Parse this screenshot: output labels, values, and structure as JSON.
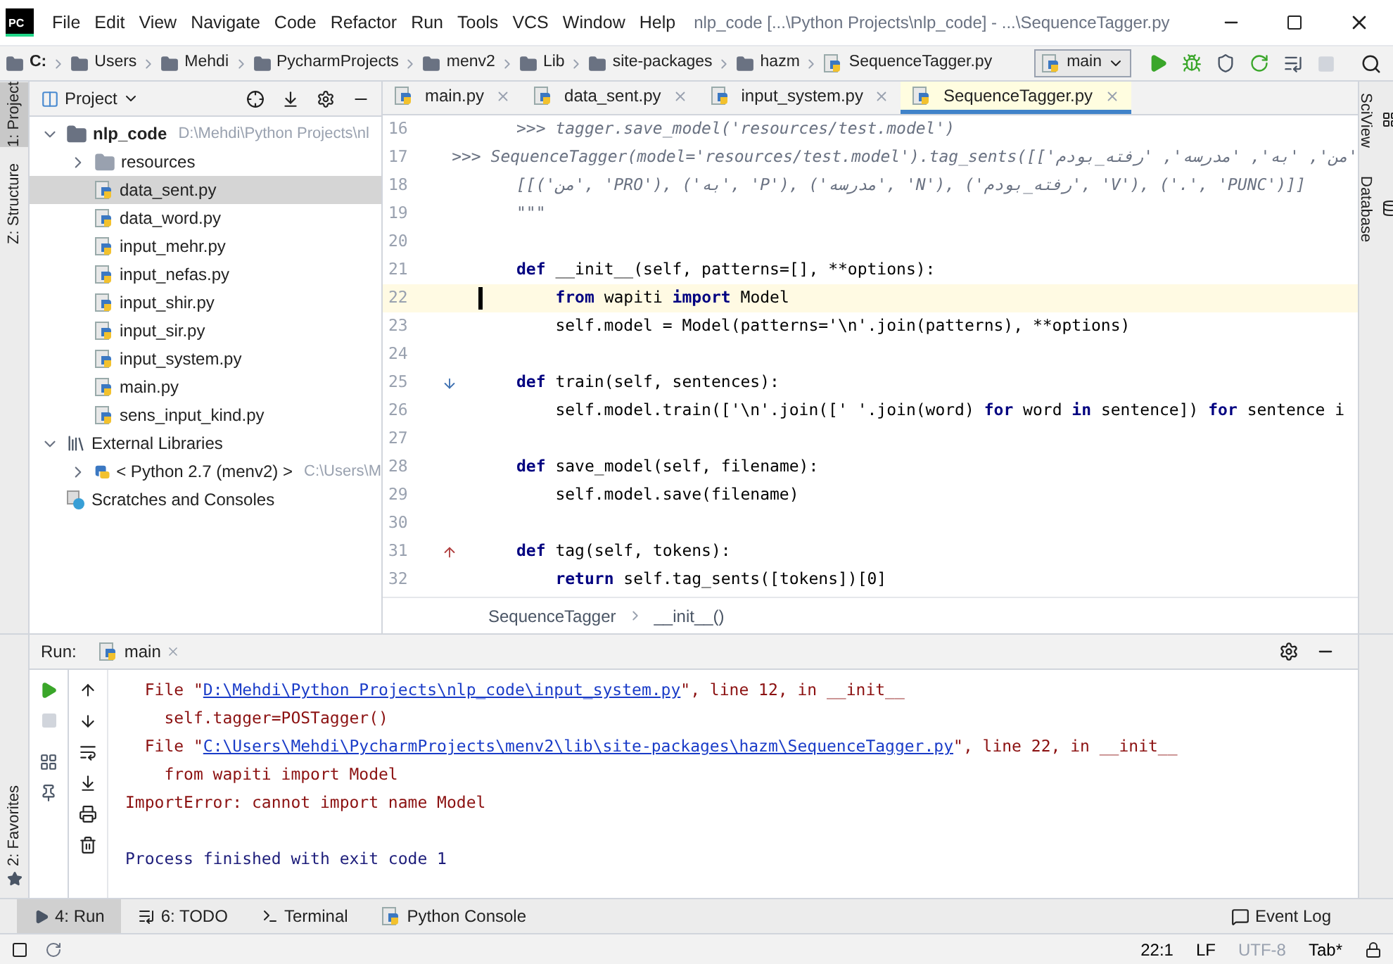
{
  "window": {
    "logo": "PC",
    "title": "nlp_code [...\\Python Projects\\nlp_code] - ...\\SequenceTagger.py"
  },
  "menu": [
    "File",
    "Edit",
    "View",
    "Navigate",
    "Code",
    "Refactor",
    "Run",
    "Tools",
    "VCS",
    "Window",
    "Help"
  ],
  "breadcrumb": [
    "C:",
    "Users",
    "Mehdi",
    "PycharmProjects",
    "menv2",
    "Lib",
    "site-packages",
    "hazm",
    "SequenceTagger.py"
  ],
  "run_config": "main",
  "left_stripe": [
    {
      "label": "1: Project",
      "selected": true
    },
    {
      "label": "Z: Structure",
      "selected": false
    }
  ],
  "favorites": "2: Favorites",
  "right_stripe": [
    "SciView",
    "Database"
  ],
  "project": {
    "title": "Project",
    "tree": [
      {
        "label": "nlp_code",
        "hint": "D:\\Mehdi\\Python Projects\\nl",
        "kind": "root",
        "expanded": true,
        "selected": false,
        "children": [
          {
            "label": "resources",
            "kind": "folder",
            "expanded": false,
            "selected": false
          },
          {
            "label": "data_sent.py",
            "kind": "file",
            "selected": true
          },
          {
            "label": "data_word.py",
            "kind": "file",
            "selected": false
          },
          {
            "label": "input_mehr.py",
            "kind": "file",
            "selected": false
          },
          {
            "label": "input_nefas.py",
            "kind": "file",
            "selected": false
          },
          {
            "label": "input_shir.py",
            "kind": "file",
            "selected": false
          },
          {
            "label": "input_sir.py",
            "kind": "file",
            "selected": false
          },
          {
            "label": "input_system.py",
            "kind": "file",
            "selected": false
          },
          {
            "label": "main.py",
            "kind": "file",
            "selected": false
          },
          {
            "label": "sens_input_kind.py",
            "kind": "file",
            "selected": false
          }
        ]
      },
      {
        "label": "External Libraries",
        "kind": "library",
        "expanded": true,
        "selected": false,
        "children": [
          {
            "label": "< Python 2.7 (menv2) >",
            "hint": "C:\\Users\\M",
            "kind": "python",
            "expanded": false,
            "selected": false
          }
        ]
      },
      {
        "label": "Scratches and Consoles",
        "kind": "scratches",
        "selected": false
      }
    ]
  },
  "editor": {
    "tabs": [
      {
        "label": "main.py",
        "selected": false
      },
      {
        "label": "data_sent.py",
        "selected": false
      },
      {
        "label": "input_system.py",
        "selected": false
      },
      {
        "label": "SequenceTagger.py",
        "selected": true
      }
    ],
    "lines": [
      {
        "n": "16",
        "kind": "doc",
        "text": ">>> tagger.save_model('resources/test.model')"
      },
      {
        "n": "17",
        "kind": "doc",
        "text": ">>> SequenceTagger(model='resources/test.model').tag_sents([['من', 'به', 'مدرسه', 'رفته_بودم'"
      },
      {
        "n": "18",
        "kind": "doc",
        "text": "[[('من', 'PRO'), ('به', 'P'), ('مدرسه', 'N'), ('رفته_بودم', 'V'), ('.', 'PUNC')]]"
      },
      {
        "n": "19",
        "kind": "doc",
        "text": "\"\"\""
      },
      {
        "n": "20",
        "kind": "blank"
      },
      {
        "n": "21",
        "kind": "code",
        "text": "**def** __init__(self, patterns=[], **options):"
      },
      {
        "n": "22",
        "kind": "code",
        "current": true,
        "text": "    **from** wapiti **import** Model"
      },
      {
        "n": "23",
        "kind": "code",
        "text": "    self.model = Model(patterns='\\n'.join(patterns), **options)"
      },
      {
        "n": "24",
        "kind": "blank"
      },
      {
        "n": "25",
        "kind": "code",
        "marker": {
          "kind": "down"
        },
        "text": "**def** train(self, sentences):"
      },
      {
        "n": "26",
        "kind": "code",
        "text": "    self.model.train(['\\n'.join([' '.join(word) **for** word **in** sentence]) **for** sentence i"
      },
      {
        "n": "27",
        "kind": "blank"
      },
      {
        "n": "28",
        "kind": "code",
        "text": "**def** save_model(self, filename):"
      },
      {
        "n": "29",
        "kind": "code",
        "text": "    self.model.save(filename)"
      },
      {
        "n": "30",
        "kind": "blank"
      },
      {
        "n": "31",
        "kind": "code",
        "marker": {
          "kind": "up"
        },
        "text": "**def** tag(self, tokens):"
      },
      {
        "n": "32",
        "kind": "code",
        "text": "    **return** self.tag_sents([tokens])[0]"
      }
    ],
    "path": [
      "SequenceTagger",
      "__init__()"
    ]
  },
  "run": {
    "title": "Run:",
    "tab": "main",
    "output": [
      {
        "kind": "text",
        "segments": [
          {
            "kind": "err",
            "text": "  File \""
          },
          {
            "kind": "link",
            "text": "D:\\Mehdi\\Python Projects\\nlp_code\\input_system.py"
          },
          {
            "kind": "err",
            "text": "\", line 12, in __init__"
          }
        ]
      },
      {
        "kind": "text",
        "segments": [
          {
            "kind": "err",
            "text": "    self.tagger=POSTagger()"
          }
        ]
      },
      {
        "kind": "text",
        "segments": [
          {
            "kind": "err",
            "text": "  File \""
          },
          {
            "kind": "link",
            "text": "C:\\Users\\Mehdi\\PycharmProjects\\menv2\\lib\\site-packages\\hazm\\SequenceTagger.py"
          },
          {
            "kind": "err",
            "text": "\", line 22, in __init__"
          }
        ]
      },
      {
        "kind": "text",
        "segments": [
          {
            "kind": "err",
            "text": "    from wapiti import Model"
          }
        ]
      },
      {
        "kind": "text",
        "segments": [
          {
            "kind": "err",
            "text": "ImportError: cannot import name Model"
          }
        ]
      },
      {
        "kind": "blank"
      },
      {
        "kind": "text",
        "segments": [
          {
            "kind": "info",
            "text": "Process finished with exit code 1"
          }
        ]
      }
    ]
  },
  "tool_tabs": [
    {
      "label": "4: Run",
      "selected": true
    },
    {
      "label": "6: TODO",
      "selected": false
    },
    {
      "label": "Terminal",
      "selected": false
    },
    {
      "label": "Python Console",
      "selected": false
    }
  ],
  "event_log": "Event Log",
  "status": [
    {
      "text": "22:1",
      "disabled": false
    },
    {
      "text": "LF",
      "disabled": false
    },
    {
      "text": "UTF-8",
      "disabled": true
    },
    {
      "text": "Tab*",
      "disabled": false
    }
  ]
}
